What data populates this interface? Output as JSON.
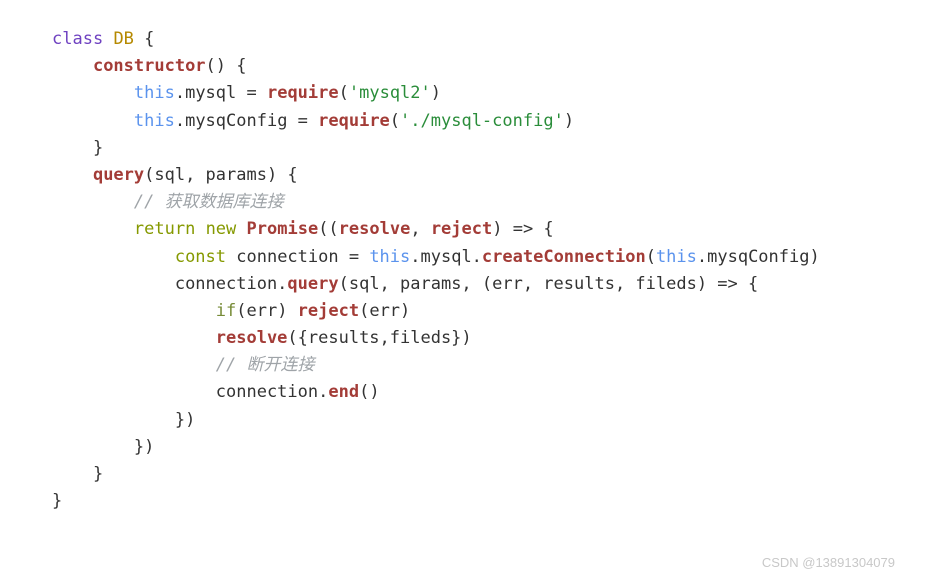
{
  "code": {
    "l1": {
      "kw": "class",
      "name": "DB",
      "brace": " {"
    },
    "l2": {
      "method": "constructor",
      "rest": "() {"
    },
    "l3": {
      "this": "this",
      "dot": ".mysql = ",
      "fn": "require",
      "paren_open": "(",
      "str": "'mysql2'",
      "paren_close": ")"
    },
    "l4": {
      "this": "this",
      "dot": ".mysqConfig = ",
      "fn": "require",
      "paren_open": "(",
      "str": "'./mysql-config'",
      "paren_close": ")"
    },
    "l5": {
      "brace": "}"
    },
    "l6": {
      "method": "query",
      "rest": "(sql, params) {"
    },
    "l7": {
      "comment": "// 获取数据库连接"
    },
    "l8": {
      "ret": "return",
      "nw": "new",
      "prom": "Promise",
      "open": "((",
      "resolve": "resolve",
      "comma": ", ",
      "reject": "reject",
      "close": ") => {"
    },
    "l9": {
      "const": "const",
      "eq": " connection = ",
      "this": "this",
      "dot": ".mysql.",
      "fn": "createConnection",
      "open": "(",
      "this2": "this",
      "dot2": ".mysqConfig)"
    },
    "l10": {
      "conn": "connection.",
      "fn": "query",
      "args": "(sql, params, (err, results, fileds) => {"
    },
    "l11": {
      "if": "if",
      "rest": "(err) ",
      "fn": "reject",
      "args": "(err)"
    },
    "l12": {
      "fn": "resolve",
      "args": "({results,fileds})"
    },
    "l13": {
      "comment": "// 断开连接"
    },
    "l14": {
      "conn": "connection.",
      "fn": "end",
      "args": "()"
    },
    "l15": {
      "brace": "})"
    },
    "l16": {
      "brace": "})"
    },
    "l17": {
      "brace": "}"
    },
    "l18": {
      "brace": "}"
    }
  },
  "watermark": "CSDN @13891304079"
}
